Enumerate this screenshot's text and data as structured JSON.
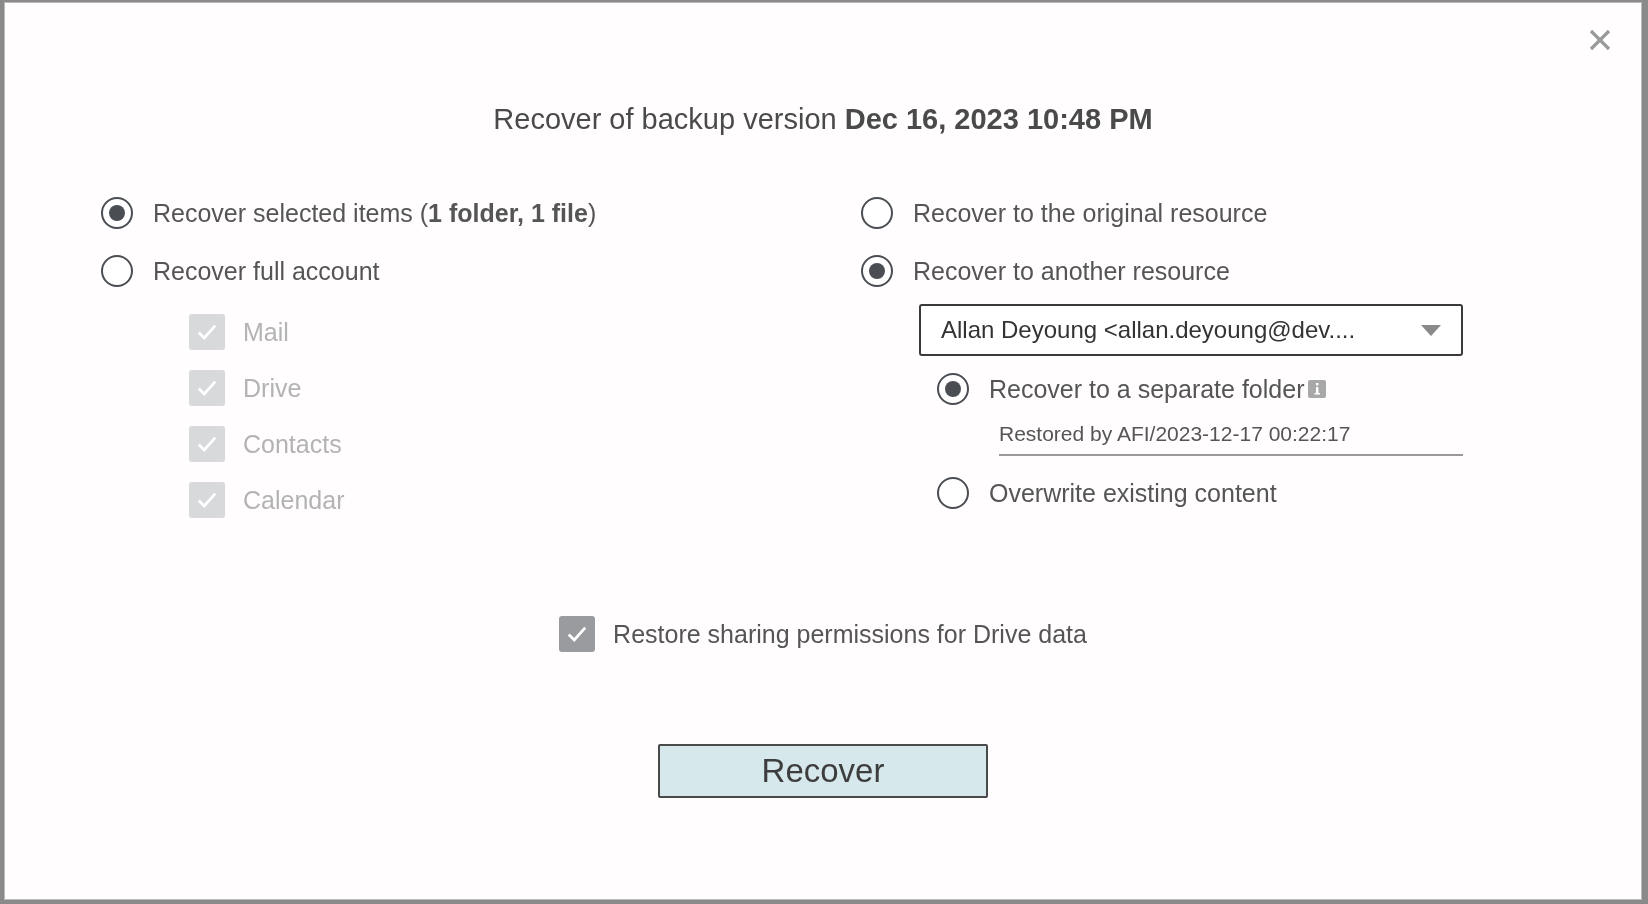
{
  "dialog": {
    "title": "Recover of backup version **Dec 16, 2023 10:48 PM**",
    "scope_options": [
      {
        "label": "Recover selected items (**1 folder, 1 file**)",
        "selected": true
      },
      {
        "label": "Recover full account",
        "selected": false
      }
    ],
    "services": [
      {
        "label": "Mail",
        "checked": true,
        "disabled": true
      },
      {
        "label": "Drive",
        "checked": true,
        "disabled": true
      },
      {
        "label": "Contacts",
        "checked": true,
        "disabled": true
      },
      {
        "label": "Calendar",
        "checked": true,
        "disabled": true
      }
    ],
    "destination_options": [
      {
        "label": "Recover to the original resource",
        "selected": false
      },
      {
        "label": "Recover to another resource",
        "selected": true
      }
    ],
    "resource_select": {
      "value": "Allan Deyoung <allan.deyoung@dev...."
    },
    "mode_options": [
      {
        "label": "Recover to a separate folder",
        "selected": true,
        "info": true
      },
      {
        "label": "Overwrite existing content",
        "selected": false,
        "info": false
      }
    ],
    "folder_name": {
      "value": "Restored by AFI/2023-12-17 00:22:17"
    },
    "sharing_permissions": {
      "label": "Restore sharing permissions for Drive data",
      "checked": true
    },
    "recover_button": "Recover"
  }
}
